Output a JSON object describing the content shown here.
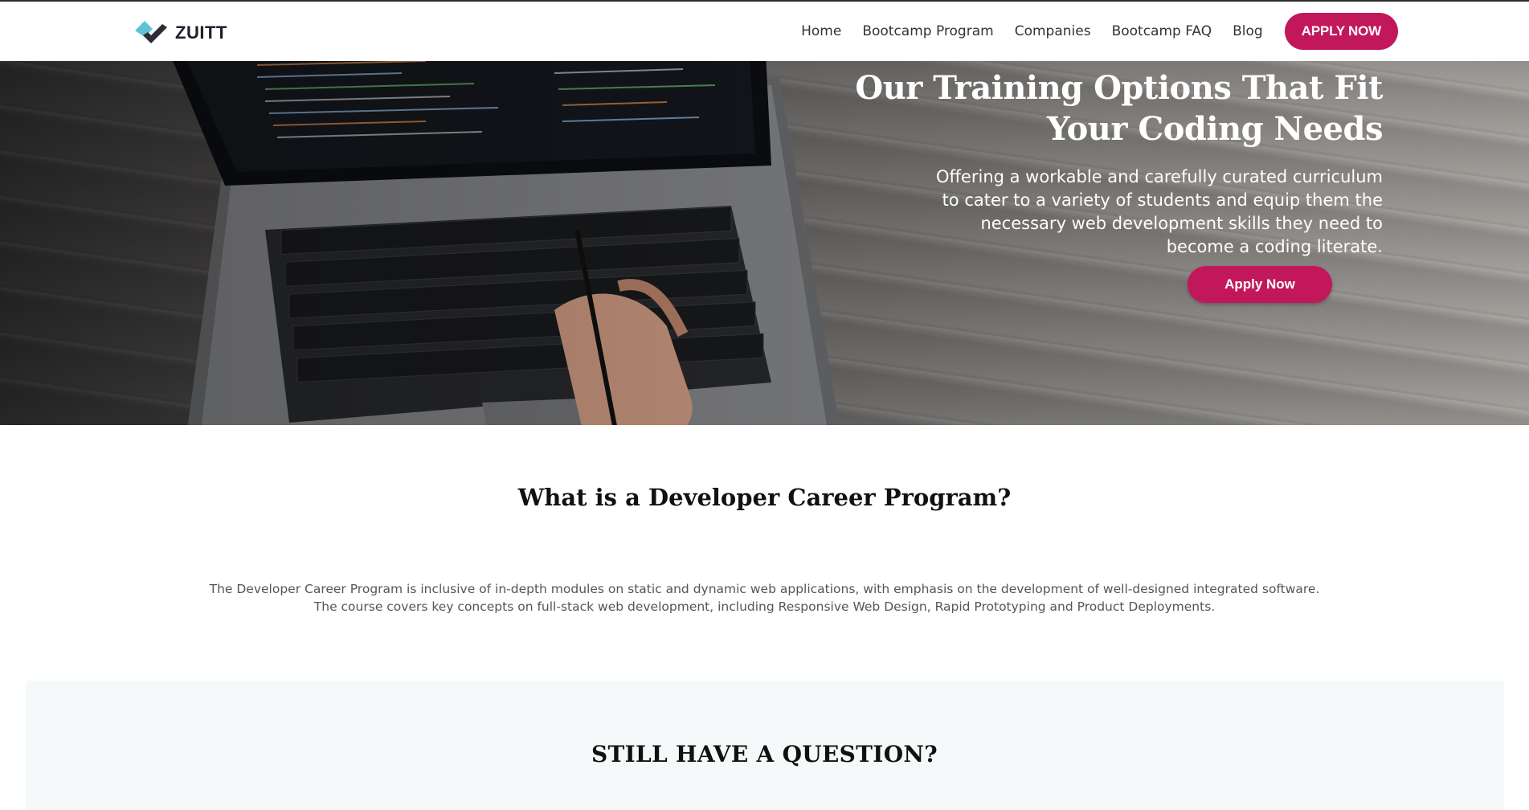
{
  "brand": {
    "name": "ZUITT",
    "accent_color": "#c2185b",
    "logo_colors": [
      "#5ec4d4",
      "#2a2c38"
    ]
  },
  "nav": {
    "items": [
      {
        "label": "Home"
      },
      {
        "label": "Bootcamp Program"
      },
      {
        "label": "Companies"
      },
      {
        "label": "Bootcamp FAQ"
      },
      {
        "label": "Blog"
      }
    ],
    "cta_label": "APPLY NOW"
  },
  "hero": {
    "title": "Our Training Options That Fit Your Coding Needs",
    "subtitle": "Offering a workable and carefully curated curriculum to cater to a variety of students and equip them the necessary web development skills they need to become a coding literate.",
    "cta_label": "Apply Now",
    "image": "laptop-on-wooden-desk"
  },
  "developer_career": {
    "title": "What is a Developer Career Program?",
    "description": "The Developer Career Program is inclusive of in-depth modules on static and dynamic web applications, with emphasis on the development of well-designed integrated software. The course covers key concepts on full-stack web development, including Responsive Web Design, Rapid Prototyping and Product Deployments."
  },
  "question_section": {
    "title": "STILL HAVE A QUESTION?"
  }
}
